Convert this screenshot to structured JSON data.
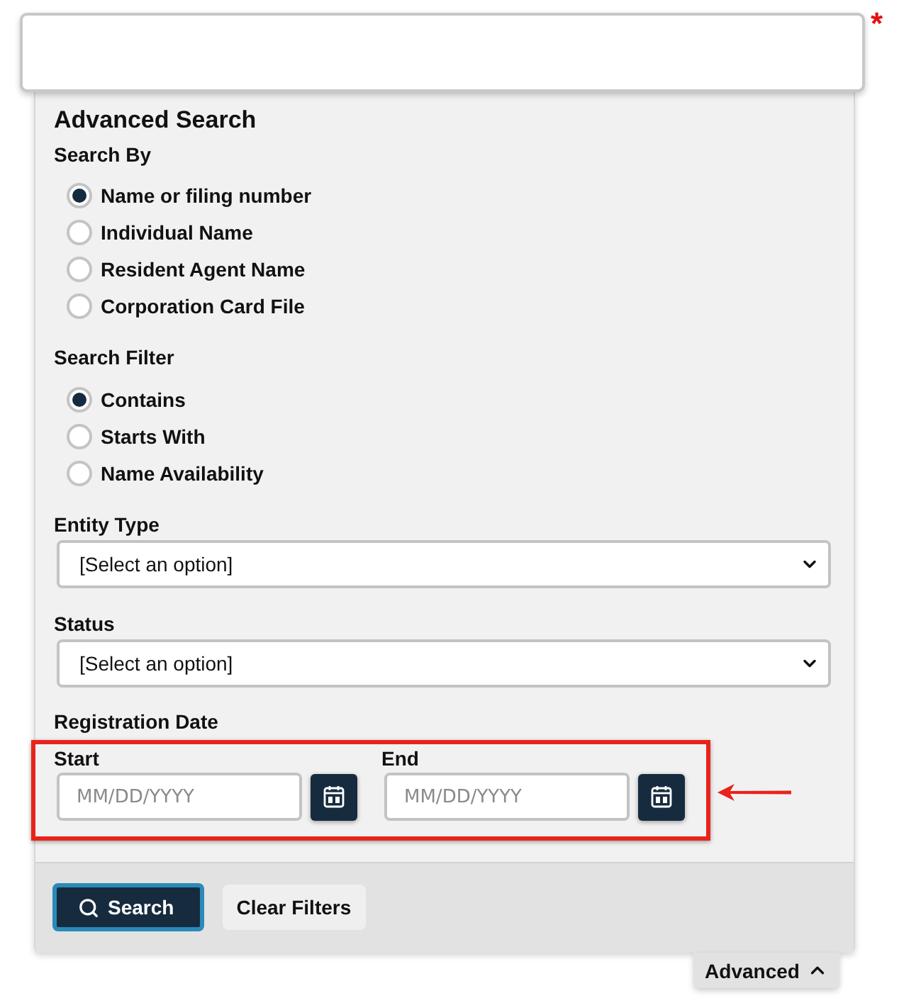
{
  "search_box": {
    "required_mark": "*"
  },
  "advanced_search": {
    "title": "Advanced Search",
    "search_by": {
      "label": "Search By",
      "options": [
        {
          "label": "Name or filing number",
          "selected": true
        },
        {
          "label": "Individual Name",
          "selected": false
        },
        {
          "label": "Resident Agent Name",
          "selected": false
        },
        {
          "label": "Corporation Card File",
          "selected": false
        }
      ]
    },
    "search_filter": {
      "label": "Search Filter",
      "options": [
        {
          "label": "Contains",
          "selected": true
        },
        {
          "label": "Starts With",
          "selected": false
        },
        {
          "label": "Name Availability",
          "selected": false
        }
      ]
    },
    "entity_type": {
      "label": "Entity Type",
      "value": "[Select an option]"
    },
    "status": {
      "label": "Status",
      "value": "[Select an option]"
    },
    "registration_date": {
      "label": "Registration Date",
      "highlighted": true,
      "start": {
        "label": "Start",
        "placeholder": "MM/DD/YYYY"
      },
      "end": {
        "label": "End",
        "placeholder": "MM/DD/YYYY"
      }
    },
    "actions": [
      {
        "label": "Search",
        "kind": "primary",
        "focused": true
      },
      {
        "label": "Clear Filters",
        "kind": "secondary",
        "focused": false
      }
    ]
  },
  "advanced_toggle": {
    "label": "Advanced",
    "expanded": true
  }
}
